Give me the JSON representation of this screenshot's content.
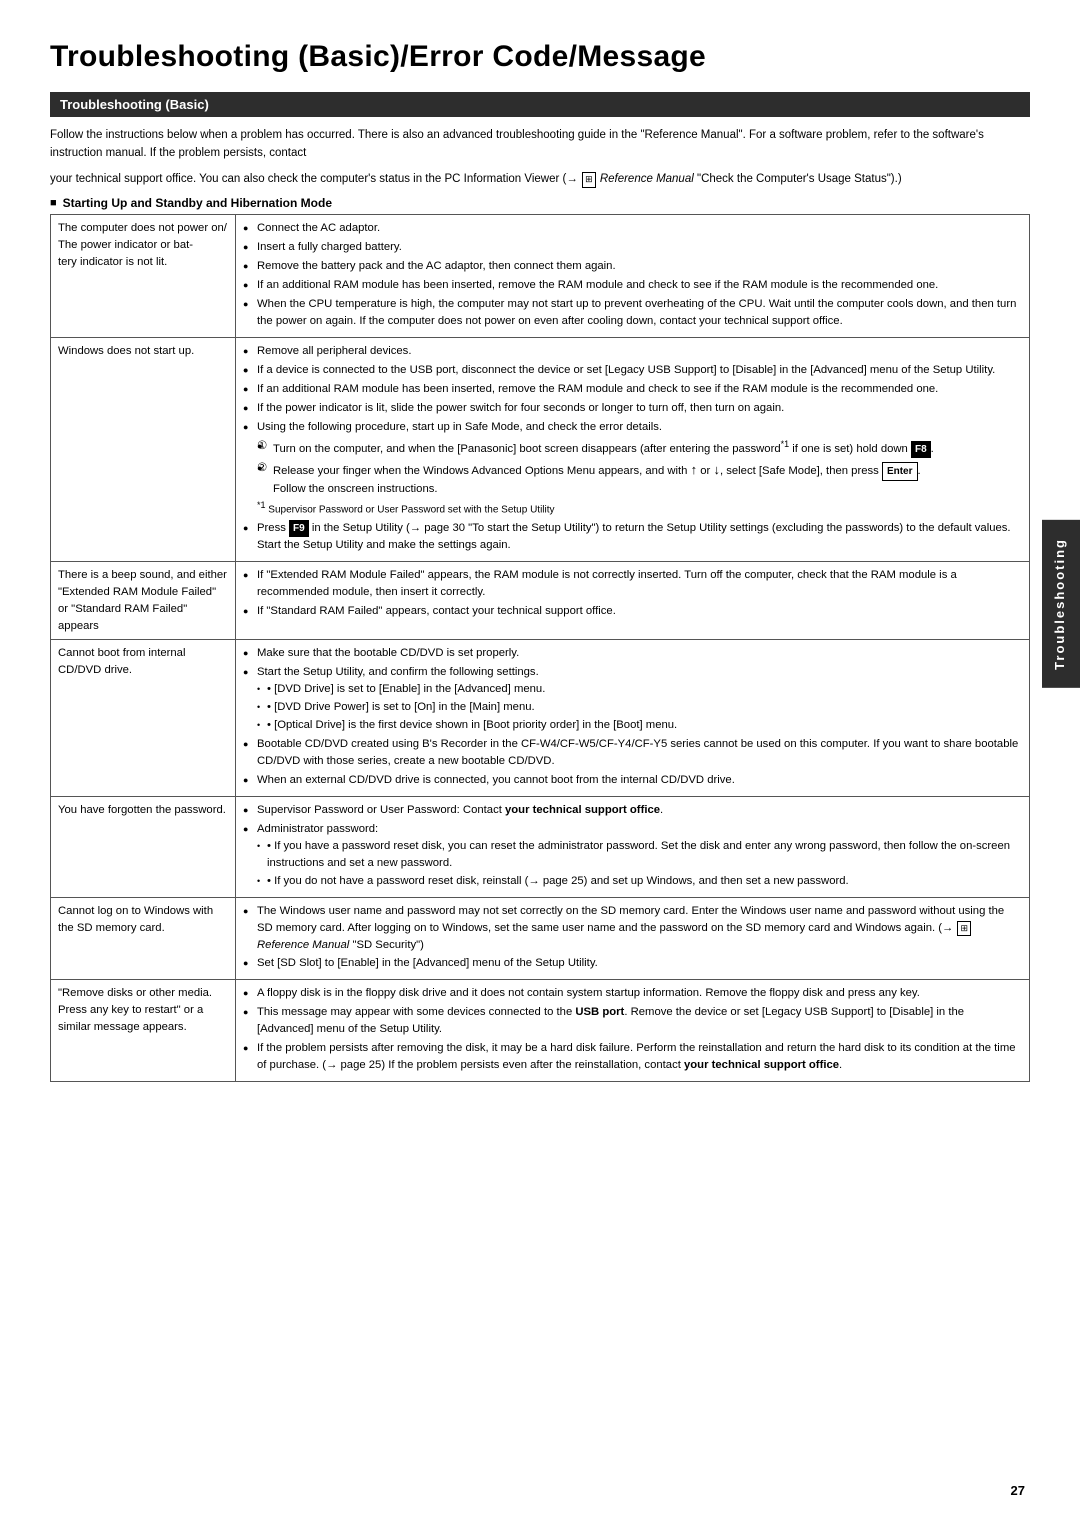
{
  "page": {
    "title": "Troubleshooting (Basic)/Error Code/Message",
    "page_number": "27"
  },
  "section": {
    "header": "Troubleshooting (Basic)",
    "intro1": "Follow the instructions below when a problem has occurred. There is also an advanced troubleshooting guide in the \"Reference Manual\". For a software problem, refer to the software's instruction manual. If the problem persists, contact",
    "intro2": "your technical support office. You can also check the computer's status in the PC Information Viewer (→",
    "intro2_ref": "Reference Manual",
    "intro2_suffix": "\"Check the Computer's Usage Status\").",
    "subsection_header": "Starting Up and Standby and Hibernation Mode",
    "side_tab": "Troubleshooting"
  },
  "table": {
    "rows": [
      {
        "problem": "The computer does not power on/\nThe power indicator or battery indicator is not lit.",
        "solutions": [
          "Connect the AC adaptor.",
          "Insert a fully charged battery.",
          "Remove the battery pack and the AC adaptor, then connect them again.",
          "If an additional RAM module has been inserted, remove the RAM module and check to see if the RAM module is the recommended one.",
          "When the CPU temperature is high, the computer may not start up to prevent overheating of the CPU. Wait until the computer cools down, and then turn the power on again. If the computer does not power on even after cooling down, contact your technical support office."
        ]
      },
      {
        "problem": "Windows does not start up.",
        "solutions_complex": true
      },
      {
        "problem": "There is a beep sound, and either \"Extended RAM Module Failed\" or \"Standard RAM Failed\" appears",
        "solutions": [
          "If \"Extended RAM Module Failed\" appears, the RAM module is not correctly inserted. Turn off the computer, check that the RAM module is a recommended module, then insert it correctly.",
          "If \"Standard RAM Failed\" appears, contact your technical support office."
        ]
      },
      {
        "problem": "Cannot boot from internal CD/DVD drive.",
        "solutions_boot": true
      },
      {
        "problem": "You have forgotten the password.",
        "solutions_password": true
      },
      {
        "problem": "Cannot log on to Windows with the SD memory card.",
        "solutions_sd": true
      },
      {
        "problem": "\"Remove disks or other media. Press any key to restart\" or a similar message appears.",
        "solutions_disk": true
      }
    ]
  }
}
